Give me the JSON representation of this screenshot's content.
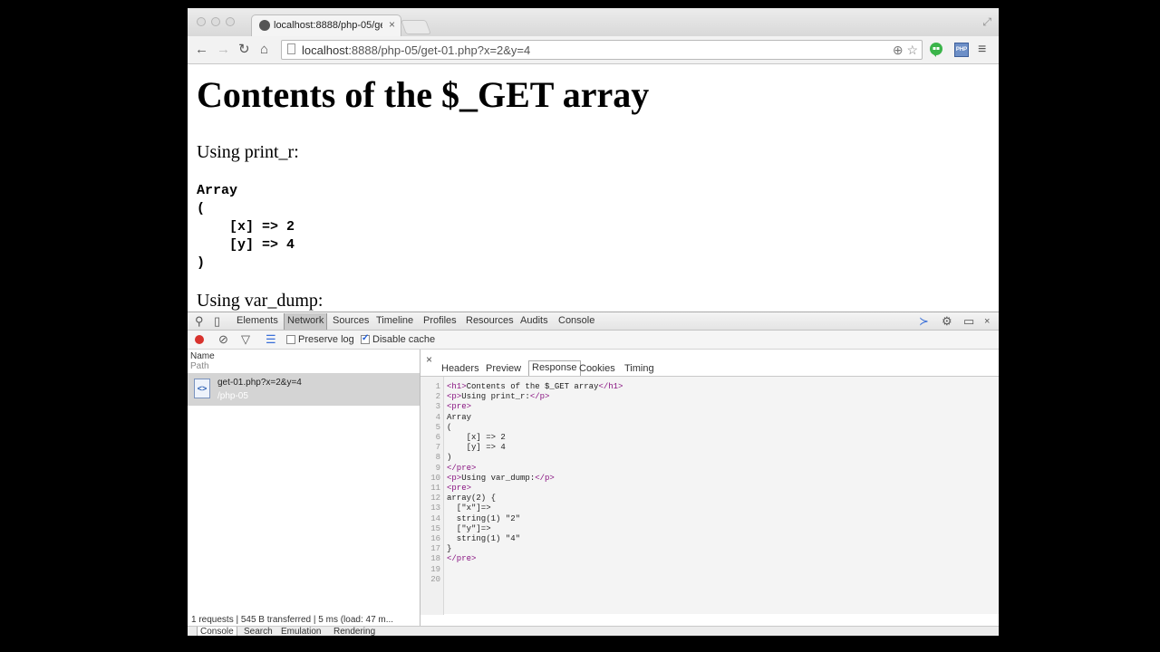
{
  "browser": {
    "tab_title": "localhost:8888/php-05/get",
    "tab_close": "×",
    "url_host": "localhost",
    "url_rest": ":8888/php-05/get-01.php?x=2&y=4",
    "extension_label": "PHP"
  },
  "page": {
    "heading": "Contents of the $_GET array",
    "print_r_label": "Using print_r:",
    "print_r_output": "Array\n(\n    [x] => 2\n    [y] => 4\n)",
    "var_dump_label": "Using var_dump:"
  },
  "devtools": {
    "tabs": [
      "Elements",
      "Network",
      "Sources",
      "Timeline",
      "Profiles",
      "Resources",
      "Audits",
      "Console"
    ],
    "active_tab": "Network",
    "toolbar": {
      "preserve_log_label": "Preserve log",
      "preserve_log_checked": false,
      "disable_cache_label": "Disable cache",
      "disable_cache_checked": true
    },
    "columns": {
      "name": "Name",
      "path": "Path"
    },
    "request": {
      "name": "get-01.php?x=2&y=4",
      "path": "/php-05",
      "icon_label": "<>"
    },
    "detail_tabs": [
      "Headers",
      "Preview",
      "Response",
      "Cookies",
      "Timing"
    ],
    "active_detail_tab": "Response",
    "close_glyph": "×",
    "response_lines": [
      "<h1>Contents of the $_GET array</h1>",
      "<p>Using print_r:</p>",
      "<pre>",
      "Array",
      "(",
      "    [x] => 2",
      "    [y] => 4",
      ")",
      "</pre>",
      "<p>Using var_dump:</p>",
      "<pre>",
      "array(2) {",
      "  [\"x\"]=>",
      "  string(1) \"2\"",
      "  [\"y\"]=>",
      "  string(1) \"4\"",
      "}",
      "</pre>",
      "",
      ""
    ],
    "status": "1 requests | 545 B transferred | 5 ms (load: 47 m...",
    "drawer_tabs": [
      "Console",
      "Search",
      "Emulation",
      "Rendering"
    ],
    "active_drawer_tab": "Console"
  }
}
